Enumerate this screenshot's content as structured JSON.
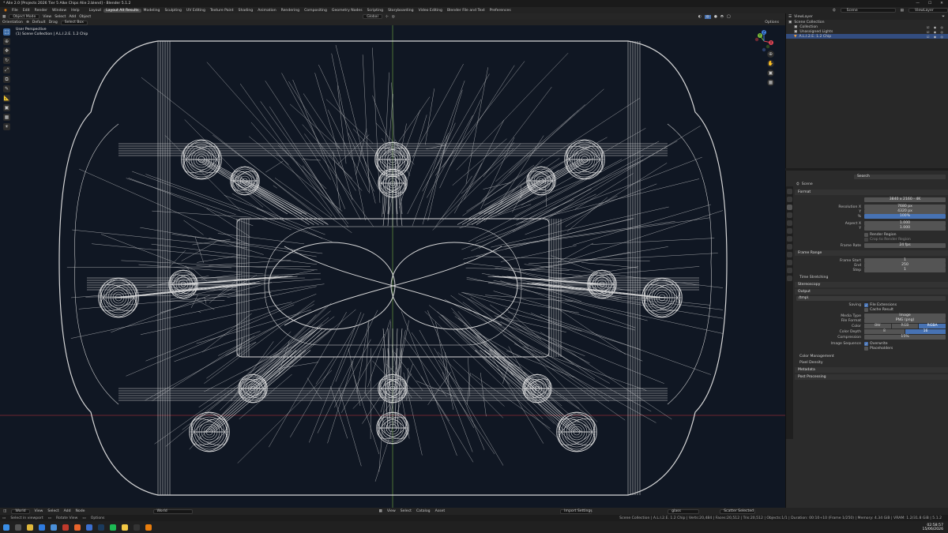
{
  "window": {
    "title": "* Alie 2.0 [Projects 2026 Tier 5 Alke Chips Alie 2.blend] - Blender 5.1.2"
  },
  "menu": [
    "File",
    "Edit",
    "Render",
    "Window",
    "Help"
  ],
  "workspaces": [
    "Layout",
    "Layout Alt Results",
    "Modeling",
    "Sculpting",
    "UV Editing",
    "Texture Paint",
    "Shading",
    "Animation",
    "Rendering",
    "Compositing",
    "Geometry Nodes",
    "Scripting",
    "Storyboarding",
    "Video Editing",
    "Blender File and Text",
    "Preferences"
  ],
  "active_workspace": "Layout Alt Results",
  "scene_field": "Scene",
  "viewlayer_field": "ViewLayer",
  "viewport_header": {
    "mode": "Object Mode",
    "menus": [
      "View",
      "Select",
      "Add",
      "Object"
    ],
    "pivot": "Global",
    "options": "Options"
  },
  "viewport_header2": {
    "orientation_label": "Orientation",
    "orientation": "Default",
    "drag_label": "Drag",
    "drag": "Select Box"
  },
  "viewport_info": {
    "view": "User Perspective",
    "collection": "(1) Scene Collection | A.L.I.2.E. 1.2 Chip"
  },
  "gizmo": {
    "x": "X",
    "y": "Y",
    "z": "Z"
  },
  "outliner": {
    "search": "ViewLayer",
    "rows": [
      {
        "label": "Scene Collection",
        "vis": ""
      },
      {
        "label": "Collection",
        "vis": "☑ ◉ ◎"
      },
      {
        "label": "Unassigned Lights",
        "vis": "☑ ◉ ◎"
      },
      {
        "label": "A.L.I.2.E. 1.2 Chip",
        "vis": "☑ ◉ ◎"
      }
    ]
  },
  "properties": {
    "search": "Search",
    "context": "Scene",
    "format_title": "Format",
    "preset": "3840 x 2160 - 4K",
    "res_x_label": "Resolution X",
    "res_x": "7680 px",
    "res_y_label": "Y",
    "res_y": "4320 px",
    "res_pct_label": "%",
    "res_pct": "100%",
    "aspect_x_label": "Aspect X",
    "aspect_x": "1.000",
    "aspect_y_label": "Y",
    "aspect_y": "1.000",
    "render_region": "Render Region",
    "crop_region": "Crop to Render Region",
    "fps_label": "Frame Rate",
    "fps": "24 fps",
    "frame_range_title": "Frame Range",
    "start_label": "Frame Start",
    "start": "1",
    "end_label": "End",
    "end": "250",
    "step_label": "Step",
    "step": "1",
    "time_stretch": "Time Stretching",
    "stereoscopy": "Stereoscopy",
    "output_title": "Output",
    "output_path": "/tmp\\",
    "saving_label": "Saving",
    "file_ext": "File Extensions",
    "cache_result": "Cache Result",
    "media_label": "Media Type",
    "media": "Image",
    "format_label": "File Format",
    "format": "PNG (png)",
    "color_label": "Color",
    "color_opts": [
      "BW",
      "RGB",
      "RGBA"
    ],
    "depth_label": "Color Depth",
    "depth_opts": [
      "8",
      "16"
    ],
    "comp_label": "Compression",
    "comp": "15%",
    "seq_label": "Image Sequence",
    "overwrite": "Overwrite",
    "placeholders": "Placeholders",
    "color_mgmt": "Color Management",
    "pixel_density": "Pixel Density",
    "metadata": "Metadata",
    "post": "Post Processing"
  },
  "bottom_header": {
    "world": "World",
    "menus": [
      "View",
      "Select",
      "Add",
      "Node"
    ],
    "world_field": "World",
    "slot": "Slot",
    "node_menus": [
      "View",
      "Select",
      "Catalog",
      "Asset"
    ],
    "import": "Import Settings",
    "search": "glass",
    "filter": "Scatter Selected"
  },
  "status": {
    "left": [
      "Select in viewport",
      "Rotate View",
      "Options"
    ],
    "right": "Scene Collection | A.L.I.2.E. 1.2 Chip | Verts:20,484 | Faces:20,512 | Tris:20,512 | Objects:1/1 | Duration: 00:10+10 (Frame 1/250) | Memory: 4.34 GiB | VRAM: 1.2/31.8 GiB | 5.1.2"
  },
  "clock": {
    "time": "02:58:57",
    "date": "15/06/2026"
  }
}
